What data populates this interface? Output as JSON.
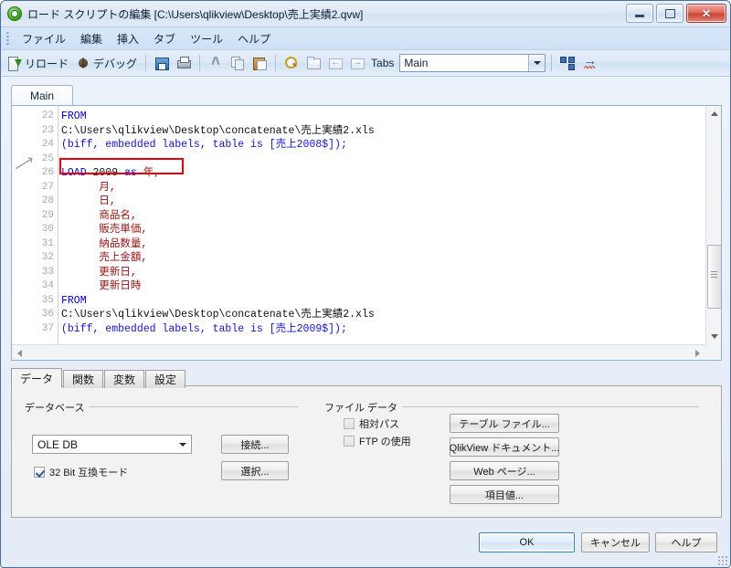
{
  "window": {
    "title": "ロード スクリプトの編集 [C:\\Users\\qlikview\\Desktop\\売上実績2.qvw]",
    "icon": "qlikview-logo-icon",
    "minimize_label": "",
    "maximize_label": "",
    "close_label": "✕"
  },
  "menu": {
    "items": [
      {
        "label": "ファイル"
      },
      {
        "label": "編集"
      },
      {
        "label": "挿入"
      },
      {
        "label": "タブ"
      },
      {
        "label": "ツール"
      },
      {
        "label": "ヘルプ"
      }
    ]
  },
  "toolbar": {
    "reload_label": "リロード",
    "debug_label": "デバッグ",
    "tabs_label": "Tabs",
    "tab_combo_value": "Main",
    "icons": {
      "reload": "reload-icon",
      "debug": "debug-bug-icon",
      "save": "save-icon",
      "print": "print-icon",
      "cut": "cut-icon",
      "copy": "copy-icon",
      "paste": "paste-icon",
      "find": "find-magnifier-icon",
      "folder": "folder-icon",
      "folder_prev": "folder-back-icon",
      "folder_next": "folder-forward-icon",
      "tab_network": "tab-network-icon",
      "goto": "goto-arrow-icon"
    }
  },
  "editor": {
    "tab_label": "Main",
    "first_line_number": 22,
    "highlight_line": 26,
    "breakpoint_marker_icon": "pointer-arrow-icon",
    "lines": [
      {
        "no": 22,
        "tokens": [
          {
            "t": "FROM",
            "c": "kw"
          }
        ]
      },
      {
        "no": 23,
        "tokens": [
          {
            "t": "C:\\Users\\qlikview\\Desktop\\concatenate\\売上実績2.xls",
            "c": "blk"
          }
        ]
      },
      {
        "no": 24,
        "tokens": [
          {
            "t": "(biff, embedded labels, table is [売上2008$]);",
            "c": "blu"
          }
        ]
      },
      {
        "no": 25,
        "tokens": [
          {
            "t": "",
            "c": "blk"
          }
        ]
      },
      {
        "no": 26,
        "tokens": [
          {
            "t": "LOAD",
            "c": "kw"
          },
          {
            "t": " 2009 ",
            "c": "blk"
          },
          {
            "t": "as",
            "c": "kw"
          },
          {
            "t": " ",
            "c": "blk"
          },
          {
            "t": "年,",
            "c": "fld"
          }
        ]
      },
      {
        "no": 27,
        "tokens": [
          {
            "t": "      月,",
            "c": "fld"
          }
        ]
      },
      {
        "no": 28,
        "tokens": [
          {
            "t": "      日,",
            "c": "fld"
          }
        ]
      },
      {
        "no": 29,
        "tokens": [
          {
            "t": "      商品名,",
            "c": "fld"
          }
        ]
      },
      {
        "no": 30,
        "tokens": [
          {
            "t": "      販売単価,",
            "c": "fld"
          }
        ]
      },
      {
        "no": 31,
        "tokens": [
          {
            "t": "      納品数量,",
            "c": "fld"
          }
        ]
      },
      {
        "no": 32,
        "tokens": [
          {
            "t": "      売上金額,",
            "c": "fld"
          }
        ]
      },
      {
        "no": 33,
        "tokens": [
          {
            "t": "      更新日,",
            "c": "fld"
          }
        ]
      },
      {
        "no": 34,
        "tokens": [
          {
            "t": "      更新日時",
            "c": "fld"
          }
        ]
      },
      {
        "no": 35,
        "tokens": [
          {
            "t": "FROM",
            "c": "kw"
          }
        ]
      },
      {
        "no": 36,
        "tokens": [
          {
            "t": "C:\\Users\\qlikview\\Desktop\\concatenate\\売上実績2.xls",
            "c": "blk"
          }
        ]
      },
      {
        "no": 37,
        "tokens": [
          {
            "t": "(biff, embedded labels, table is [売上2009$]);",
            "c": "blu"
          }
        ]
      }
    ]
  },
  "options_tabs": [
    {
      "label": "データ",
      "active": true
    },
    {
      "label": "関数",
      "active": false
    },
    {
      "label": "変数",
      "active": false
    },
    {
      "label": "設定",
      "active": false
    }
  ],
  "database_group": {
    "title": "データベース",
    "provider_value": "OLE DB",
    "connect_button": "接続...",
    "select_button": "選択...",
    "compat_checkbox_label": "32 Bit 互換モード",
    "compat_checked": true
  },
  "file_data_group": {
    "title": "ファイル データ",
    "relative_path_label": "相対パス",
    "relative_path_checked": false,
    "use_ftp_label": "FTP の使用",
    "use_ftp_checked": false,
    "buttons": [
      {
        "label": "テーブル ファイル..."
      },
      {
        "label": "QlikView ドキュメント..."
      },
      {
        "label": "Web ページ..."
      },
      {
        "label": "項目値..."
      }
    ]
  },
  "footer": {
    "ok_label": "OK",
    "cancel_label": "キャンセル",
    "help_label": "ヘルプ"
  },
  "colors": {
    "highlight_box": "#e8000b",
    "keyword": "#0000cd",
    "field": "#96100f",
    "string_blue": "#1414c8"
  }
}
